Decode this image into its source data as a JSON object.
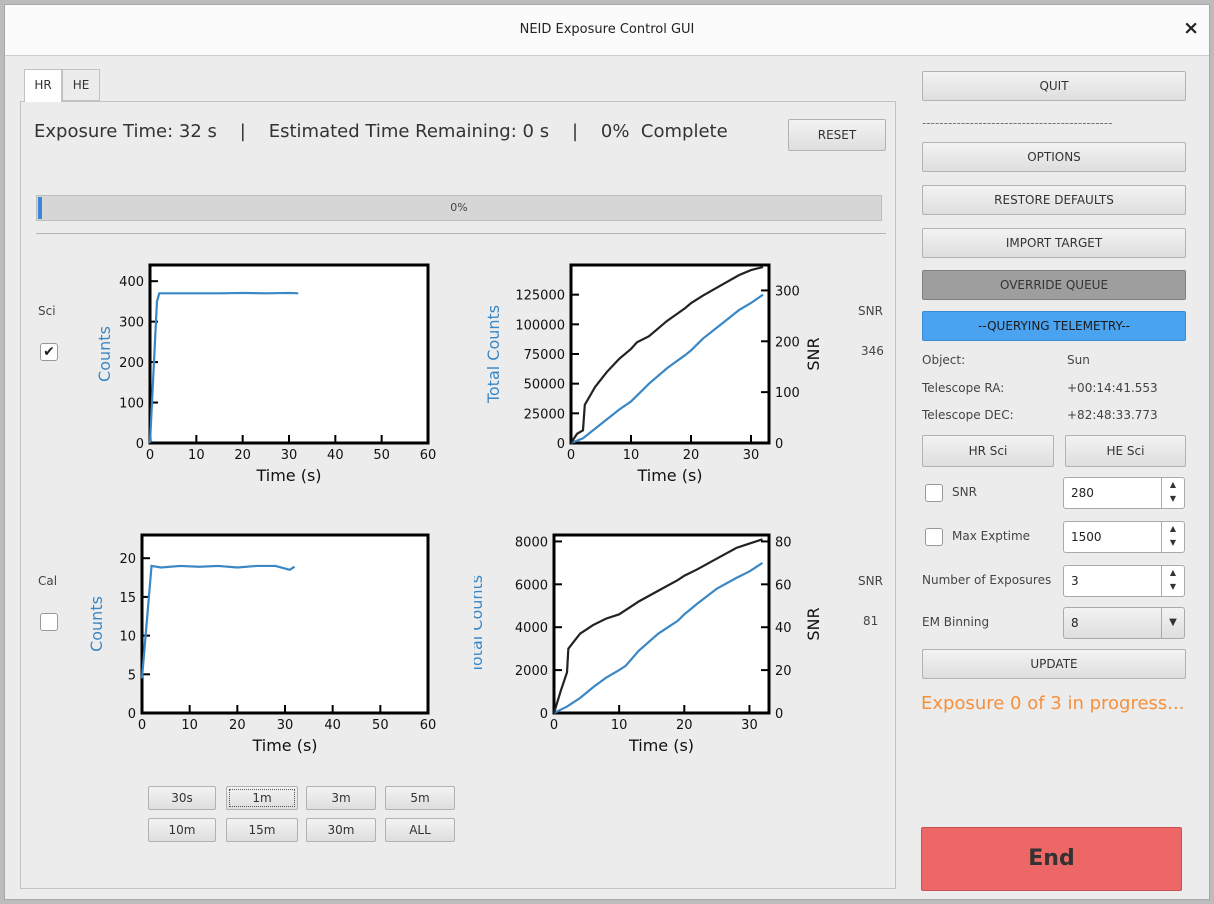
{
  "window": {
    "title": "NEID Exposure Control GUI",
    "close_label": "×"
  },
  "tabs": [
    {
      "label": "HR",
      "active": true
    },
    {
      "label": "HE",
      "active": false
    }
  ],
  "status": {
    "text": "Exposure Time: 32 s    |    Estimated Time Remaining: 0 s    |    0%  Complete",
    "reset_label": "RESET",
    "progress_percent": 0.5,
    "progress_text": "0%"
  },
  "rows": {
    "sci": {
      "label": "Sci",
      "checked": true,
      "checkmark": "✔",
      "snr_label": "SNR",
      "snr_value": "346"
    },
    "cal": {
      "label": "Cal",
      "checked": false,
      "checkmark": "",
      "snr_label": "SNR",
      "snr_value": "81"
    }
  },
  "time_buttons": [
    "30s",
    "1m",
    "3m",
    "5m",
    "10m",
    "15m",
    "30m",
    "ALL"
  ],
  "right": {
    "quit_label": "QUIT",
    "separator": "--------------------------------------------",
    "options_label": "OPTIONS",
    "restore_label": "RESTORE DEFAULTS",
    "import_label": "IMPORT TARGET",
    "override_label": "OVERRIDE QUEUE",
    "telemetry_label": "--QUERYING TELEMETRY--",
    "object_label": "Object:",
    "object_value": "Sun",
    "ra_label": "Telescope RA:",
    "ra_value": "+00:14:41.553",
    "dec_label": "Telescope DEC:",
    "dec_value": "+82:48:33.773",
    "hr_sci_label": "HR Sci",
    "he_sci_label": "HE Sci",
    "snr_cb_label": "SNR",
    "snr_input": "280",
    "maxexp_cb_label": "Max Exptime",
    "maxexp_input": "1500",
    "nexp_label": "Number of Exposures",
    "nexp_input": "3",
    "embin_label": "EM Binning",
    "embin_value": "8",
    "update_label": "UPDATE",
    "progress_message": "Exposure 0 of 3 in progress...",
    "end_label": "End",
    "colors": {
      "telemetry": "#4aa3f0",
      "override": "#9e9e9e",
      "end": "#ee6767",
      "message": "#f5903c"
    }
  },
  "chart_data": [
    {
      "type": "line",
      "xlabel": "Time (s)",
      "ylabel": "Counts",
      "xlim": [
        0,
        60
      ],
      "ylim": [
        0,
        440
      ],
      "xticks": [
        0,
        10,
        20,
        30,
        40,
        50,
        60
      ],
      "yticks": [
        0,
        100,
        200,
        300,
        400
      ],
      "series": [
        {
          "x": [
            0,
            1.5,
            2,
            5,
            10,
            15,
            20,
            25,
            30,
            32
          ],
          "y": [
            0,
            350,
            370,
            370,
            370,
            370,
            371,
            370,
            371,
            370
          ],
          "color": "#3a87c6"
        }
      ]
    },
    {
      "type": "line",
      "xlabel": "Time (s)",
      "ylabel": "Total Counts",
      "y2label": "SNR",
      "xlim": [
        0,
        33
      ],
      "ylim": [
        0,
        150000
      ],
      "y2lim": [
        0,
        350
      ],
      "xticks": [
        0,
        10,
        20,
        30
      ],
      "yticks": [
        0,
        25000,
        50000,
        75000,
        100000,
        125000
      ],
      "y2ticks": [
        0,
        100,
        200,
        300
      ],
      "series": [
        {
          "axis": "left",
          "x": [
            0,
            2,
            4,
            6,
            8,
            10,
            11,
            13,
            16,
            19,
            20,
            22,
            25,
            28,
            30,
            32
          ],
          "y": [
            0,
            4000,
            12000,
            20000,
            28000,
            35000,
            40000,
            50000,
            63000,
            74000,
            78000,
            88000,
            100000,
            112000,
            118000,
            125000
          ],
          "color": "#3a87c6"
        },
        {
          "axis": "right",
          "x": [
            0,
            1,
            2,
            2.3,
            4,
            6,
            8,
            10,
            11,
            13,
            16,
            19,
            20,
            22,
            25,
            28,
            30,
            32
          ],
          "y": [
            0,
            18,
            25,
            75,
            110,
            140,
            165,
            185,
            198,
            210,
            240,
            265,
            275,
            290,
            310,
            330,
            340,
            346
          ],
          "color": "#222222"
        }
      ]
    },
    {
      "type": "line",
      "xlabel": "Time (s)",
      "ylabel": "Counts",
      "xlim": [
        0,
        60
      ],
      "ylim": [
        0,
        23
      ],
      "xticks": [
        0,
        10,
        20,
        30,
        40,
        50,
        60
      ],
      "yticks": [
        0,
        5,
        10,
        15,
        20
      ],
      "series": [
        {
          "x": [
            0,
            2,
            4,
            8,
            12,
            16,
            20,
            24,
            28,
            31,
            32
          ],
          "y": [
            4.5,
            19,
            18.8,
            19,
            18.9,
            19,
            18.8,
            19,
            19,
            18.5,
            18.9
          ],
          "color": "#3a87c6"
        }
      ]
    },
    {
      "type": "line",
      "xlabel": "Time (s)",
      "ylabel": "Total Counts",
      "y2label": "SNR",
      "xlim": [
        0,
        33
      ],
      "ylim": [
        0,
        8300
      ],
      "y2lim": [
        0,
        83
      ],
      "xticks": [
        0,
        10,
        20,
        30
      ],
      "yticks": [
        0,
        2000,
        4000,
        6000,
        8000
      ],
      "y2ticks": [
        0,
        20,
        40,
        60,
        80
      ],
      "series": [
        {
          "axis": "left",
          "x": [
            0,
            2,
            4,
            6,
            8,
            10,
            11,
            13,
            16,
            19,
            20,
            22,
            25,
            28,
            30,
            32
          ],
          "y": [
            0,
            300,
            700,
            1200,
            1650,
            2000,
            2200,
            2900,
            3700,
            4300,
            4600,
            5100,
            5800,
            6300,
            6600,
            7000
          ],
          "color": "#3a87c6"
        },
        {
          "axis": "right",
          "x": [
            0,
            1,
            2,
            2.2,
            4,
            6,
            8,
            10,
            11,
            13,
            16,
            19,
            20,
            22,
            25,
            28,
            30,
            32
          ],
          "y": [
            0,
            10,
            19,
            30,
            37,
            41,
            44,
            46,
            48,
            52,
            57,
            62,
            64,
            67,
            72,
            77,
            79,
            81
          ],
          "color": "#222222"
        }
      ]
    }
  ]
}
